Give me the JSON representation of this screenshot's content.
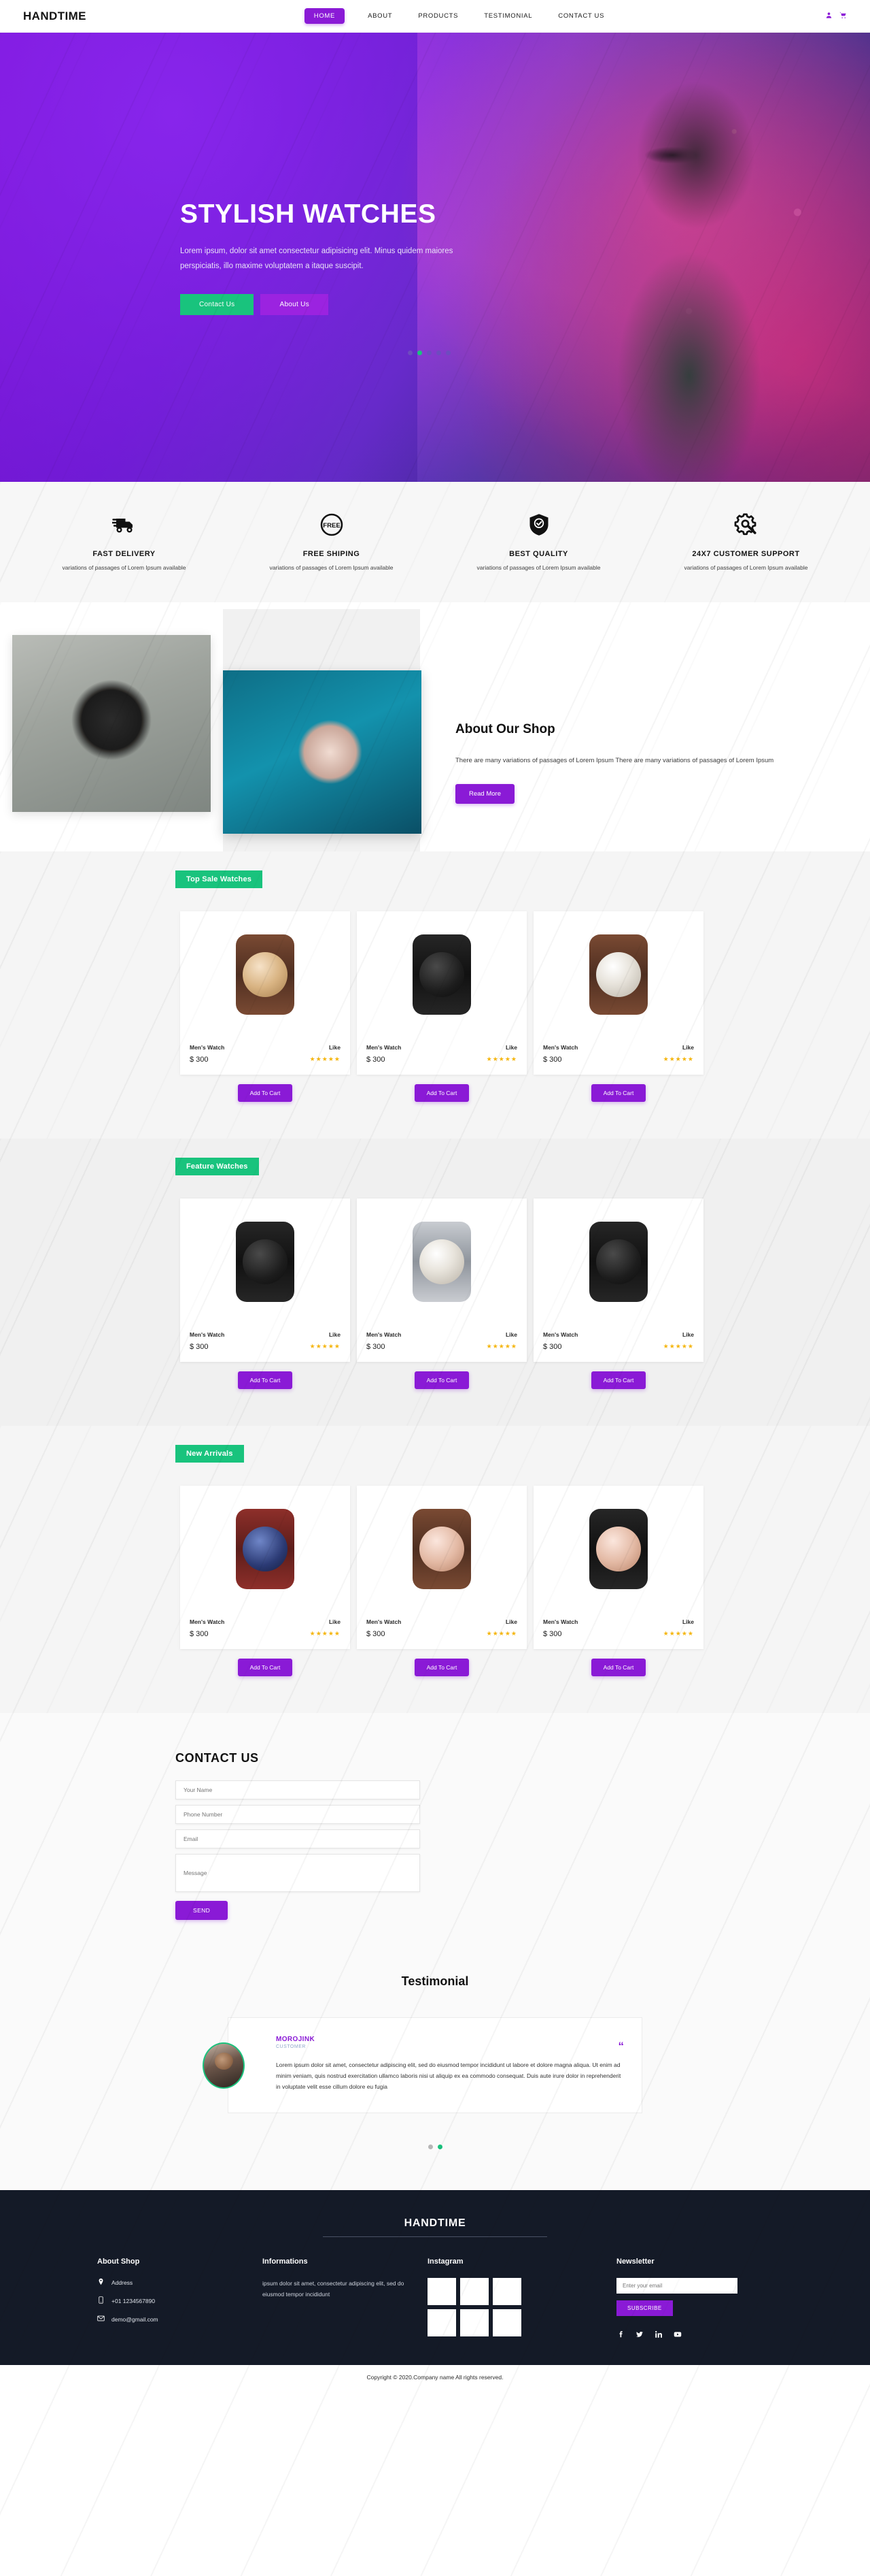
{
  "header": {
    "brand": "HANDTIME",
    "nav": [
      {
        "label": "HOME",
        "active": true
      },
      {
        "label": "ABOUT",
        "active": false
      },
      {
        "label": "PRODUCTS",
        "active": false
      },
      {
        "label": "TESTIMONIAL",
        "active": false
      },
      {
        "label": "CONTACT US",
        "active": false
      }
    ],
    "icons": [
      "user-icon",
      "cart-icon"
    ]
  },
  "hero": {
    "title": "STYLISH WATCHES",
    "paragraph": "Lorem ipsum, dolor sit amet consectetur adipisicing elit. Minus quidem maiores perspiciatis, illo maxime voluptatem a itaque suscipit.",
    "btn_contact": "Contact Us",
    "btn_about": "About Us",
    "dots": 5,
    "active_dot": 1,
    "accent_green": "#19c37d",
    "accent_purple": "#9b23e0"
  },
  "features": [
    {
      "icon": "truck-icon",
      "title": "FAST DELIVERY",
      "text": "variations of passages of Lorem Ipsum available"
    },
    {
      "icon": "free-badge-icon",
      "title": "FREE SHIPING",
      "text": "variations of passages of Lorem Ipsum available"
    },
    {
      "icon": "shield-check-icon",
      "title": "BEST QUALITY",
      "text": "variations of passages of Lorem Ipsum available"
    },
    {
      "icon": "gear-wrench-icon",
      "title": "24X7 CUSTOMER SUPPORT",
      "text": "variations of passages of Lorem Ipsum available"
    }
  ],
  "about": {
    "title": "About Our Shop",
    "paragraph": "There are many variations of passages of Lorem Ipsum There are many variations of passages of Lorem Ipsum",
    "button": "Read More"
  },
  "sections": [
    {
      "tag": "Top Sale Watches",
      "products": [
        {
          "name": "Men's Watch",
          "price": "$ 300",
          "like": "Like",
          "stars": 5,
          "cart": "Add To Cart",
          "dial": "w-gold",
          "strap": "s-brown"
        },
        {
          "name": "Men's Watch",
          "price": "$ 300",
          "like": "Like",
          "stars": 5,
          "cart": "Add To Cart",
          "dial": "w-dark",
          "strap": "s-black"
        },
        {
          "name": "Men's Watch",
          "price": "$ 300",
          "like": "Like",
          "stars": 5,
          "cart": "Add To Cart",
          "dial": "",
          "strap": "s-brown"
        }
      ]
    },
    {
      "tag": "Feature Watches",
      "products": [
        {
          "name": "Men's Watch",
          "price": "$ 300",
          "like": "Like",
          "stars": 5,
          "cart": "Add To Cart",
          "dial": "w-dark",
          "strap": "s-black"
        },
        {
          "name": "Men's Watch",
          "price": "$ 300",
          "like": "Like",
          "stars": 5,
          "cart": "Add To Cart",
          "dial": "",
          "strap": "s-steel"
        },
        {
          "name": "Men's Watch",
          "price": "$ 300",
          "like": "Like",
          "stars": 5,
          "cart": "Add To Cart",
          "dial": "w-dark",
          "strap": "s-black"
        }
      ]
    },
    {
      "tag": "New Arrivals",
      "products": [
        {
          "name": "Men's Watch",
          "price": "$ 300",
          "like": "Like",
          "stars": 5,
          "cart": "Add To Cart",
          "dial": "w-blue",
          "strap": "s-red"
        },
        {
          "name": "Men's Watch",
          "price": "$ 300",
          "like": "Like",
          "stars": 5,
          "cart": "Add To Cart",
          "dial": "w-rose",
          "strap": "s-brown"
        },
        {
          "name": "Men's Watch",
          "price": "$ 300",
          "like": "Like",
          "stars": 5,
          "cart": "Add To Cart",
          "dial": "w-rose",
          "strap": "s-black"
        }
      ]
    }
  ],
  "contact": {
    "title": "CONTACT US",
    "name_placeholder": "Your Name",
    "phone_placeholder": "Phone Number",
    "email_placeholder": "Email",
    "message_placeholder": "Message",
    "send": "SEND"
  },
  "testimonial": {
    "title": "Testimonial",
    "name": "MOROJINK",
    "role": "CUSTOMER",
    "quote": "Lorem ipsum dolor sit amet, consectetur adipiscing elit, sed do eiusmod tempor incididunt ut labore et dolore magna aliqua. Ut enim ad minim veniam, quis nostrud exercitation ullamco laboris nisi ut aliquip ex ea commodo consequat. Duis aute irure dolor in reprehenderit in voluptate velit esse cillum dolore eu fugia",
    "quote_mark": "“",
    "dots": 2,
    "active_dot": 1
  },
  "footer": {
    "brand": "HANDTIME",
    "about": {
      "title": "About Shop",
      "address": "Address",
      "phone": "+01 1234567890",
      "email": "demo@gmail.com"
    },
    "informations": {
      "title": "Informations",
      "text": "ipsum dolor sit amet, consectetur adipiscing elit, sed do eiusmod tempor incididunt"
    },
    "instagram": {
      "title": "Instagram",
      "thumbs": [
        "it1",
        "it2",
        "it3",
        "it4",
        "it5",
        "it6"
      ]
    },
    "newsletter": {
      "title": "Newsletter",
      "placeholder": "Enter your email",
      "button": "SUBSCRIBE",
      "socials": [
        "facebook-icon",
        "twitter-icon",
        "linkedin-icon",
        "youtube-icon"
      ]
    },
    "copyright": "Copyright © 2020.Company name All rights reserved."
  }
}
